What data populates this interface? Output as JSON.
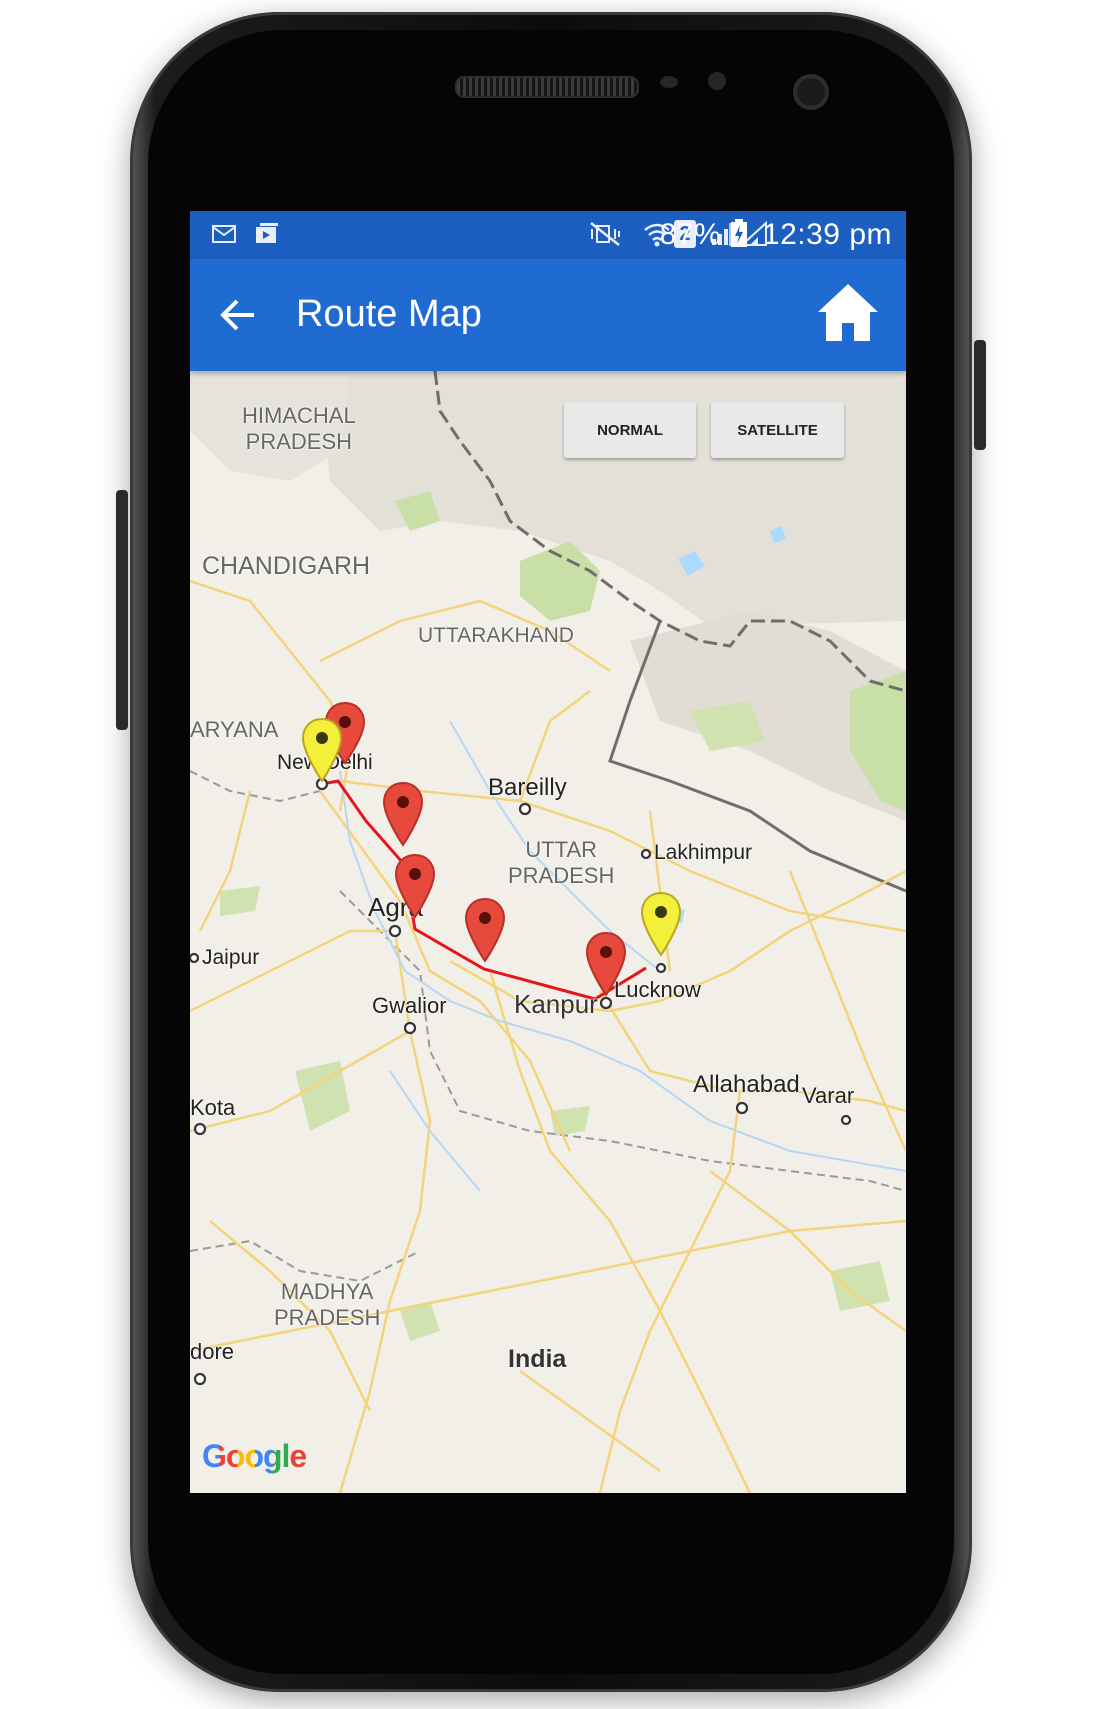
{
  "status_bar": {
    "notification_icons": [
      "mail-icon",
      "media-icon"
    ],
    "system_icons": [
      "mute-icon",
      "wifi-icon",
      "sim-2-icon",
      "signal-icon",
      "signal-icon"
    ],
    "sim_slot": "2",
    "battery_percent": "87%",
    "time": "12:39 pm"
  },
  "app_bar": {
    "title": "Route Map",
    "back_icon": "arrow-left-icon",
    "home_icon": "home-icon",
    "color": "#1f6bd1"
  },
  "map_type_buttons": {
    "normal": "NORMAL",
    "satellite": "SATELLITE"
  },
  "map": {
    "region_labels": {
      "himachal": "HIMACHAL\nPRADESH",
      "chandigarh": "CHANDIGARH",
      "uttarakhand": "UTTARAKHAND",
      "haryana": "ARYANA",
      "uttar_pradesh": "UTTAR\nPRADESH",
      "madhya_pradesh": "MADHYA\nPRADESH",
      "country": "India"
    },
    "city_labels": {
      "new_delhi": "New Delhi",
      "bareilly": "Bareilly",
      "lakhimpur": "Lakhimpur",
      "agra": "Agra",
      "jaipur": "Jaipur",
      "gwalior": "Gwalior",
      "kanpur": "Kanpur",
      "lucknow": "Lucknow",
      "allahabad": "Allahabad",
      "varanasi": "Varar",
      "kota": "Kota",
      "indore": "dore"
    },
    "attribution": "Google",
    "route_color": "#e8131b",
    "endpoint_marker_color": "#f3ef3a",
    "waypoint_marker_color": "#e8493d"
  }
}
